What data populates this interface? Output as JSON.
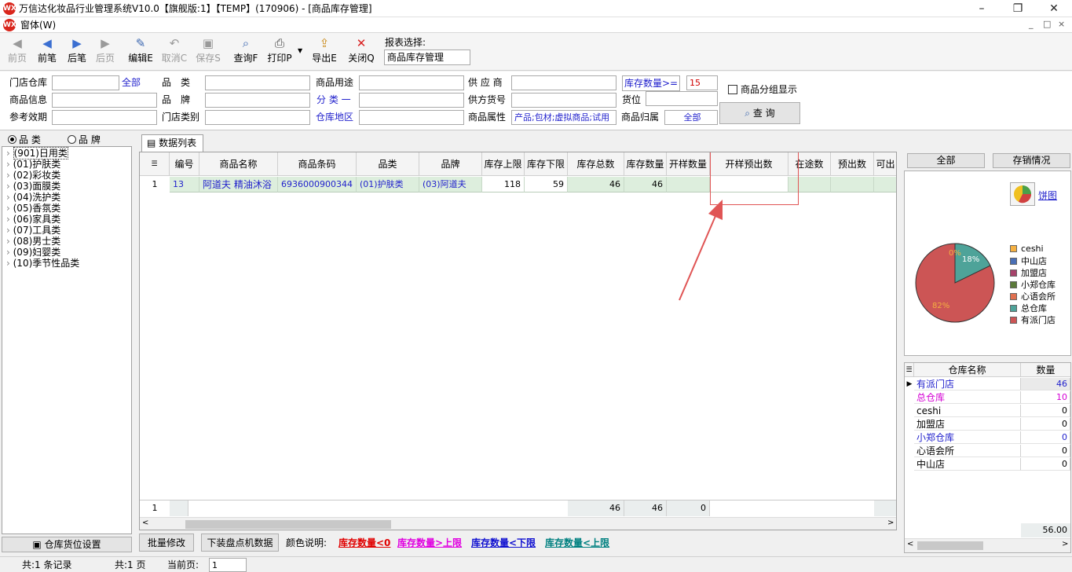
{
  "window": {
    "title": "万信达化妆品行业管理系统V10.0【旗舰版:1】【TEMP】(170906) - [商品库存管理]",
    "logo": "WXD"
  },
  "menu": {
    "window_label": "窗体(W)"
  },
  "toolbar": {
    "buttons": [
      "前页",
      "前笔",
      "后笔",
      "后页",
      "编辑E",
      "取消C",
      "保存S",
      "查询F",
      "打印P",
      "导出E",
      "关闭Q"
    ],
    "report_label": "报表选择:",
    "report_value": "商品库存管理"
  },
  "filters": {
    "store_warehouse": "门店仓库",
    "all_link": "全部",
    "category": "品　类",
    "product_use": "商品用途",
    "supplier": "供 应 商",
    "stock_qty": "库存数量>=",
    "stock_qty_value": "15",
    "group_display": "商品分组显示",
    "product_info": "商品信息",
    "brand": "品　牌",
    "classification": "分 类 一",
    "supplier_sku": "供方货号",
    "location": "货位",
    "ref_validity": "参考效期",
    "store_type": "门店类别",
    "warehouse_area": "仓库地区",
    "product_attr": "商品属性",
    "product_attr_value": "产品;包材;虚拟商品;试用",
    "product_owner": "商品归属",
    "product_owner_value": "全部",
    "query_button": "查 询"
  },
  "left": {
    "radio_category": "品 类",
    "radio_brand": "品 牌",
    "tree": [
      "(901)日用类",
      "(01)护肤类",
      "(02)彩妆类",
      "(03)面膜类",
      "(04)洗护类",
      "(05)香氛类",
      "(06)家具类",
      "(07)工具类",
      "(08)男士类",
      "(09)妇婴类",
      "(10)季节性品类"
    ],
    "location_settings": "仓库货位设置"
  },
  "tab": {
    "label": "数据列表"
  },
  "grid": {
    "columns": [
      "编号",
      "商品名称",
      "商品条码",
      "品类",
      "品牌",
      "库存上限",
      "库存下限",
      "库存总数",
      "库存数量",
      "开样数量",
      "开样预出数",
      "在途数",
      "预出数",
      "可出"
    ],
    "row": {
      "index": "1",
      "id": "13",
      "name": "阿道夫 精油沐浴",
      "barcode": "6936000900344",
      "category": "(01)护肤类",
      "brand": "(03)阿道夫",
      "upper": "118",
      "lower": "59",
      "total": "46",
      "qty": "46"
    },
    "footer": {
      "count": "1",
      "total": "46",
      "qty": "46",
      "sample": "0"
    }
  },
  "bottom": {
    "batch_edit": "批量修改",
    "download": "下装盘点机数据",
    "color_legend": "颜色说明:",
    "legends": [
      {
        "text": "库存数量<0",
        "color": "#e00000"
      },
      {
        "text": "库存数量>上限",
        "color": "#e000e0"
      },
      {
        "text": "库存数量<下限",
        "color": "#1010d0"
      },
      {
        "text": "库存数量<上限",
        "color": "#008080"
      }
    ]
  },
  "right": {
    "all_button": "全部",
    "sales_button": "存销情况",
    "pie_link": "饼图",
    "pie_labels": {
      "a": "0%",
      "b": "18%",
      "c": "82%"
    },
    "legend": [
      {
        "name": "ceshi",
        "color": "#f5b041"
      },
      {
        "name": "中山店",
        "color": "#4a6fb5"
      },
      {
        "name": "加盟店",
        "color": "#a6426a"
      },
      {
        "name": "小郑仓库",
        "color": "#5b7a3a"
      },
      {
        "name": "心语会所",
        "color": "#e07050"
      },
      {
        "name": "总仓库",
        "color": "#4ea399"
      },
      {
        "name": "有派门店",
        "color": "#cc5555"
      }
    ],
    "table_headers": [
      "仓库名称",
      "数量"
    ],
    "table_rows": [
      {
        "name": "有派门店",
        "qty": "46",
        "color": "#1f1fcc"
      },
      {
        "name": "总仓库",
        "qty": "10",
        "color": "#d400d4"
      },
      {
        "name": "ceshi",
        "qty": "0",
        "color": "#000000"
      },
      {
        "name": "加盟店",
        "qty": "0",
        "color": "#000000"
      },
      {
        "name": "小郑仓库",
        "qty": "0",
        "color": "#1f1fcc"
      },
      {
        "name": "心语会所",
        "qty": "0",
        "color": "#000000"
      },
      {
        "name": "中山店",
        "qty": "0",
        "color": "#000000"
      }
    ],
    "total": "56.00"
  },
  "status": {
    "records": "共:1 条记录",
    "pages": "共:1 页",
    "current_label": "当前页:",
    "current_value": "1"
  }
}
